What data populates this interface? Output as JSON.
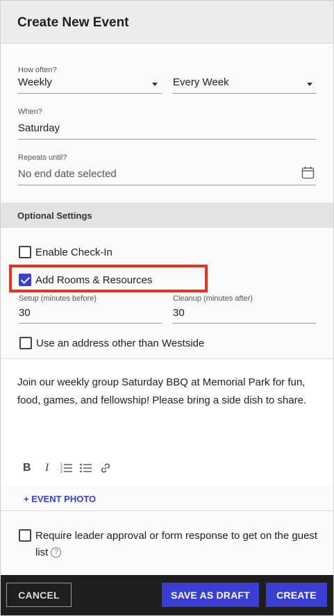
{
  "header": {
    "title": "Create New Event"
  },
  "schedule": {
    "how_often_label": "How often?",
    "frequency_value": "Weekly",
    "interval_value": "Every Week",
    "when_label": "When?",
    "when_value": "Saturday",
    "repeats_label": "Repeats until?",
    "repeats_placeholder": "No end date selected"
  },
  "optional": {
    "section_title": "Optional Settings",
    "check_in_label": "Enable Check-In",
    "rooms_label": "Add Rooms & Resources",
    "setup_label": "Setup (minutes before)",
    "setup_value": "30",
    "cleanup_label": "Cleanup (minutes after)",
    "cleanup_value": "30",
    "address_label": "Use an address other than Westside"
  },
  "description": {
    "text": "Join our weekly group Saturday BBQ at Memorial Park for fun, food, games, and fellowship! Please bring a side dish to share."
  },
  "toolbar": {
    "bold": "B",
    "italic": "I"
  },
  "photo": {
    "link_label": "+ EVENT PHOTO"
  },
  "approval": {
    "label": "Require leader approval or form response to get on the guest list"
  },
  "footer": {
    "cancel_label": "CANCEL",
    "draft_label": "SAVE AS DRAFT",
    "create_label": "CREATE"
  },
  "colors": {
    "accent": "#3a3fd1",
    "highlight": "#e8321e",
    "footer_bg": "#1e1e1e"
  },
  "state": {
    "check_in": false,
    "rooms_resources": true,
    "other_address": false,
    "leader_approval": false
  }
}
